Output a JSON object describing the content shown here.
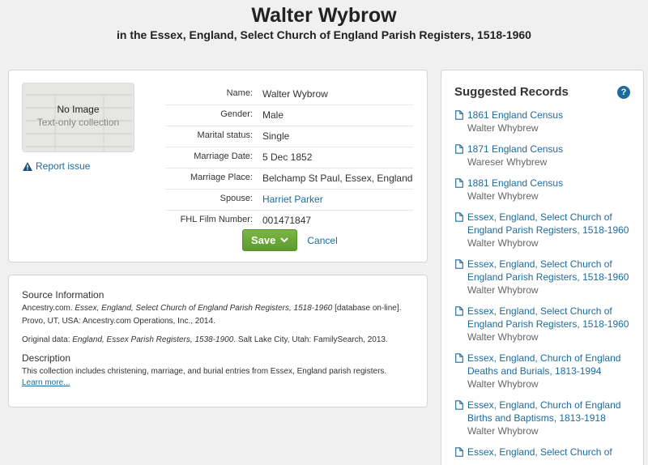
{
  "header": {
    "title": "Walter Wybrow",
    "subtitle": "in the Essex, England, Select Church of England Parish Registers, 1518-1960"
  },
  "record": {
    "thumb_no_image": "No Image",
    "thumb_subtitle": "Text-only collection",
    "report_issue": "Report issue",
    "fields": [
      {
        "label": "Name:",
        "value": "Walter Wybrow",
        "link": false
      },
      {
        "label": "Gender:",
        "value": "Male",
        "link": false
      },
      {
        "label": "Marital status:",
        "value": "Single",
        "link": false
      },
      {
        "label": "Marriage Date:",
        "value": "5 Dec 1852",
        "link": false
      },
      {
        "label": "Marriage Place:",
        "value": "Belchamp St Paul, Essex, England",
        "link": false
      },
      {
        "label": "Spouse:",
        "value": "Harriet Parker",
        "link": true
      },
      {
        "label": "FHL Film Number:",
        "value": "001471847",
        "link": false
      }
    ],
    "save_label": "Save",
    "cancel_label": "Cancel"
  },
  "source": {
    "source_title": "Source Information",
    "source_line1_a": "Ancestry.com. ",
    "source_line1_italic": "Essex, England, Select Church of England Parish Registers, 1518-1960",
    "source_line1_b": " [database on-line].",
    "source_line2": "Provo, UT, USA: Ancestry.com Operations, Inc., 2014.",
    "original_a": "Original data: ",
    "original_italic": "England, Essex Parish Registers, 1538-1900",
    "original_b": ". Salt Lake City, Utah: FamilySearch, 2013.",
    "description_title": "Description",
    "description_text": "This collection includes christening, marriage, and burial entries from Essex, England parish registers.",
    "learn_more": "Learn more..."
  },
  "suggested": {
    "title": "Suggested Records",
    "help_icon": "?",
    "items": [
      {
        "title": "1861 England Census",
        "name": "Walter Whybrew"
      },
      {
        "title": "1871 England Census",
        "name": "Wareser Whybrew"
      },
      {
        "title": "1881 England Census",
        "name": "Walter Whybrew"
      },
      {
        "title": "Essex, England, Select Church of England Parish Registers, 1518-1960",
        "name": "Walter Whybrow"
      },
      {
        "title": "Essex, England, Select Church of England Parish Registers, 1518-1960",
        "name": "Walter Whybrow"
      },
      {
        "title": "Essex, England, Select Church of England Parish Registers, 1518-1960",
        "name": "Walter Whybrow"
      },
      {
        "title": "Essex, England, Church of England Deaths and Burials, 1813-1994",
        "name": "Walter Whybrow"
      },
      {
        "title": "Essex, England, Church of England Births and Baptisms, 1813-1918",
        "name": "Walter Whybrow"
      },
      {
        "title": "Essex, England, Select Church of",
        "name": ""
      }
    ]
  },
  "colors": {
    "link": "#1d6b9c",
    "save_button": "#6aa84f",
    "background": "#f0f0f0"
  },
  "icons": {
    "report": "warning-triangle-icon",
    "save_dropdown": "chevron-down-icon",
    "record_doc": "document-icon",
    "help": "help-circle-icon"
  }
}
